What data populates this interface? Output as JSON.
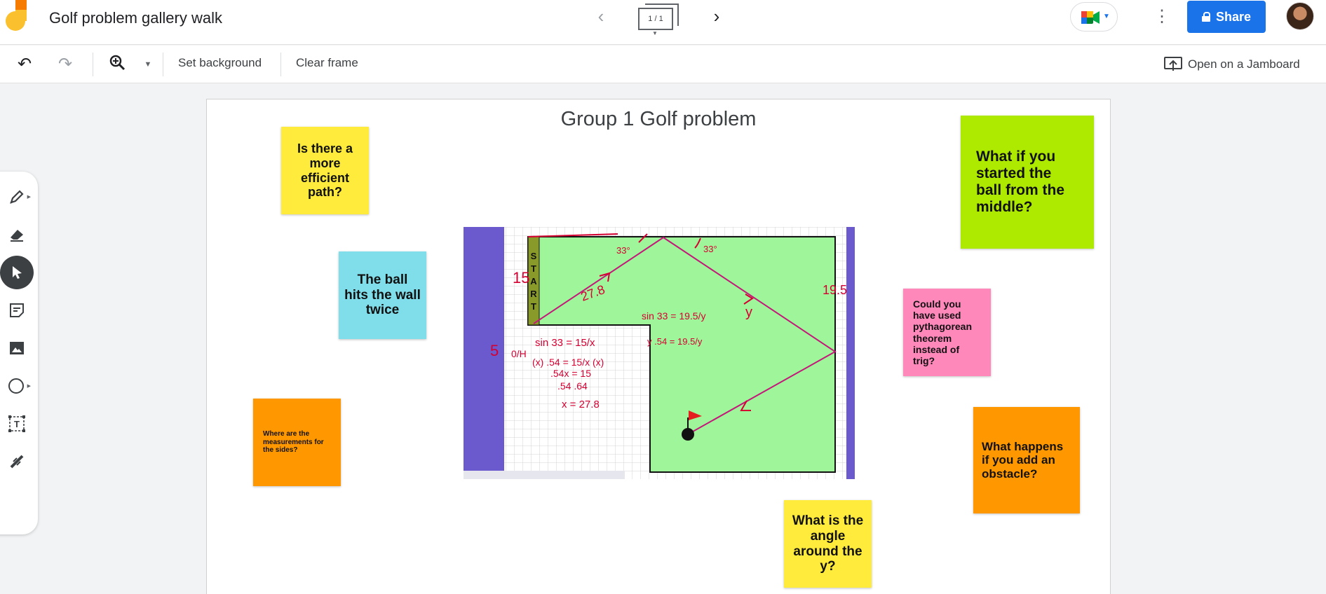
{
  "header": {
    "title": "Golf problem gallery walk",
    "frame_counter": "1 / 1",
    "share_label": "Share"
  },
  "toolbar": {
    "set_background": "Set background",
    "clear_frame": "Clear frame",
    "open_jamboard": "Open on a Jamboard"
  },
  "canvas": {
    "title": "Group 1 Golf problem"
  },
  "notes": [
    {
      "text": "Is there a more efficient path?",
      "color": "#ffeb3b"
    },
    {
      "text": "The ball hits the wall twice",
      "color": "#80deea"
    },
    {
      "text": "Where are the measurements for the sides?",
      "color": "#ff9800"
    },
    {
      "text": "What if you started the ball from the middle?",
      "color": "#aeea00"
    },
    {
      "text": "Could you have used pythagorean theorem instead of trig?",
      "color": "#ff88bb"
    },
    {
      "text": "What happens if you add an obstacle?",
      "color": "#ff9800"
    },
    {
      "text": "What is the angle around the y?",
      "color": "#ffeb3b"
    }
  ],
  "drawing": {
    "start_letters": [
      "S",
      "T",
      "A",
      "R",
      "T"
    ],
    "handwriting": [
      "15",
      "33°",
      "33°",
      "27.8",
      "19.5",
      "y",
      "5",
      "0/H",
      "sin 33 = 15/x",
      "(x) .54 = 15/x (x)",
      ".54x = 15",
      ".54   .64",
      "x = 27.8",
      "sin 33 = 19.5/y",
      "y .54 = 19.5/y"
    ]
  },
  "colors": {
    "accent": "#1a73e8",
    "ink": "#d50032",
    "course_green": "#9ff59a",
    "purple_band": "#6a5acd"
  }
}
